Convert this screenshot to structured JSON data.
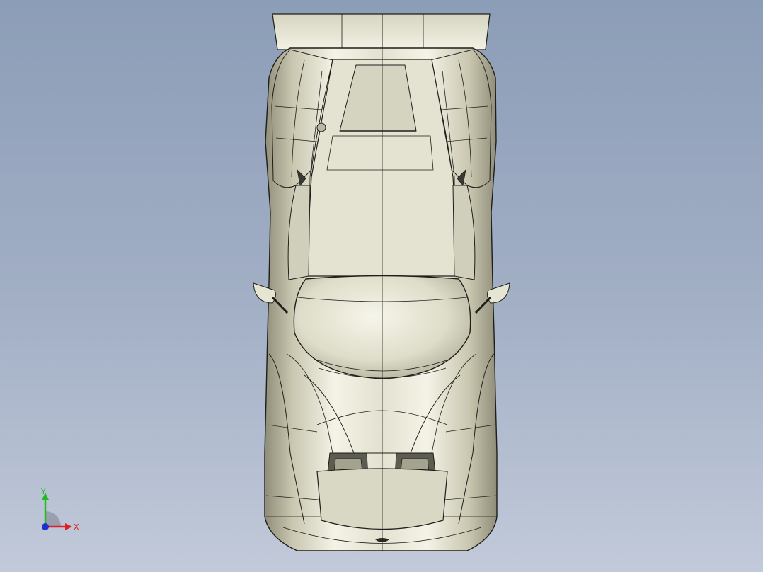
{
  "viewport": {
    "background_top": "#8c9db7",
    "background_bottom": "#c2cada",
    "model_name": "",
    "view": "top"
  },
  "triad": {
    "x_label": "X",
    "y_label": "Y",
    "x_color": "#e02020",
    "y_color": "#22bb22",
    "z_color": "#2030d0"
  },
  "model_colors": {
    "body_light": "#ecebdc",
    "body_mid": "#c9c7b0",
    "body_dark": "#8f8d78",
    "edge": "#1e1e1a"
  }
}
